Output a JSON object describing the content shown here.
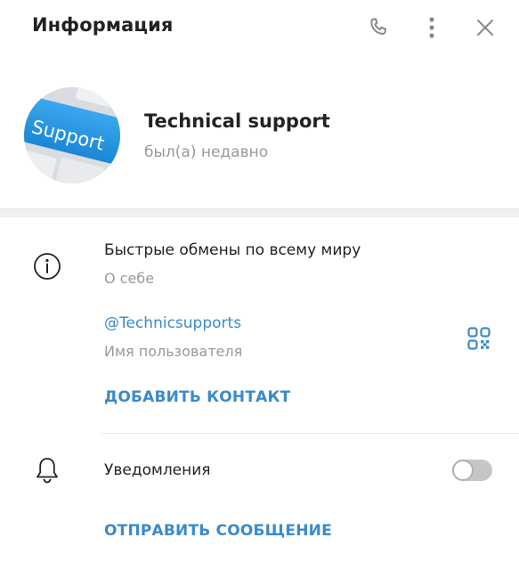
{
  "header": {
    "title": "Информация",
    "call_icon": "phone-icon",
    "more_icon": "more-vertical-icon",
    "close_icon": "close-icon"
  },
  "profile": {
    "avatar_text": "Support",
    "name": "Technical support",
    "status": "был(а) недавно"
  },
  "info": {
    "bio": "Быстрые обмены по всему миру",
    "bio_caption": "О себе",
    "username": "@Technicsupports",
    "username_caption": "Имя пользователя",
    "add_contact": "ДОБАВИТЬ КОНТАКТ",
    "info_icon": "info-icon",
    "qr_icon": "qr-code-icon"
  },
  "notifications": {
    "label": "Уведомления",
    "enabled": false,
    "bell_icon": "bell-icon"
  },
  "actions": {
    "send_message": "ОТПРАВИТЬ СООБЩЕНИЕ"
  },
  "colors": {
    "accent": "#3a8bc9",
    "text_primary": "#222222",
    "text_secondary": "#999999",
    "icon": "#8a8a8a"
  }
}
